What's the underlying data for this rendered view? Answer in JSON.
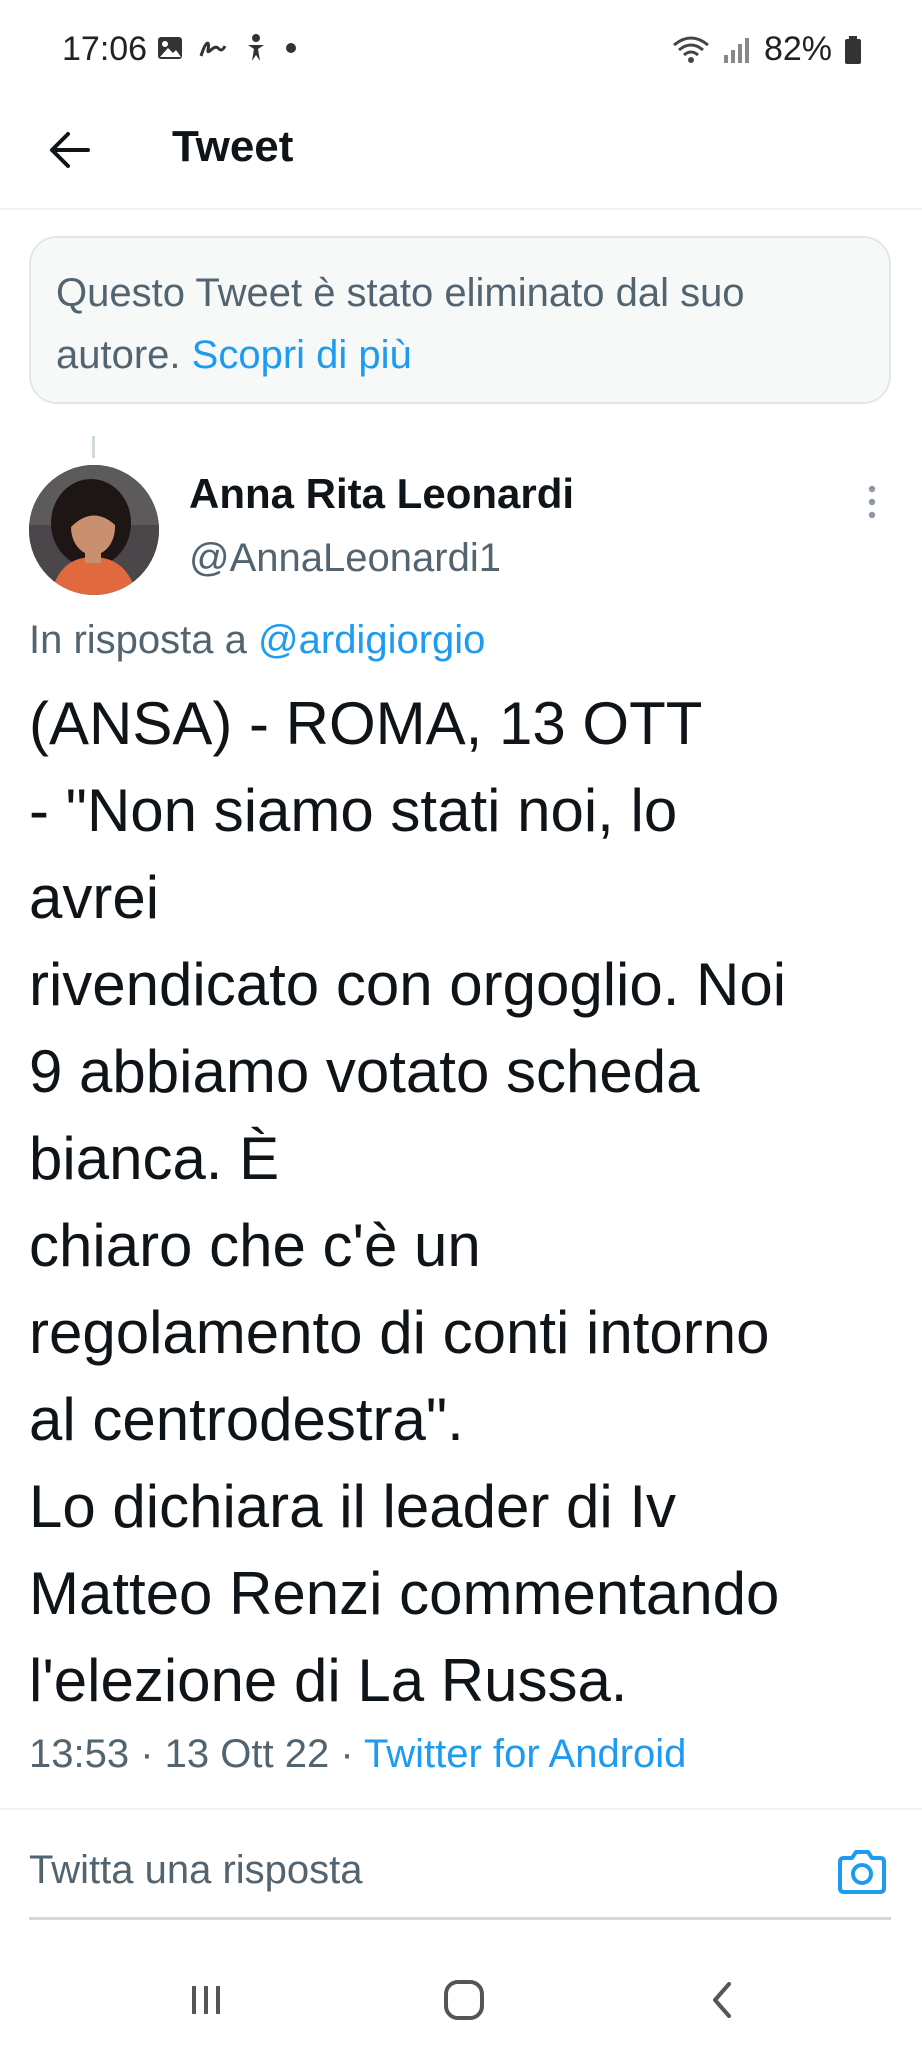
{
  "status_bar": {
    "time": "17:06",
    "battery": "82%"
  },
  "header": {
    "title": "Tweet"
  },
  "deleted_notice": {
    "text": "Questo Tweet è stato eliminato dal suo autore. ",
    "link": "Scopri di più"
  },
  "author": {
    "name": "Anna Rita Leonardi",
    "handle": "@AnnaLeonardi1"
  },
  "reply_to": {
    "prefix": "In risposta a ",
    "handle": "@ardigiorgio"
  },
  "tweet": {
    "text": "(ANSA) - ROMA, 13 OTT\n- \"Non siamo stati noi, lo\navrei\nrivendicato con orgoglio. Noi\n9 abbiamo votato scheda\nbianca. È\nchiaro che c'è un\nregolamento di conti intorno\nal centrodestra\".\nLo dichiara il leader di Iv\nMatteo Renzi commentando\nl'elezione di La Russa.",
    "time": "13:53",
    "date": "13 Ott 22",
    "source": "Twitter for Android"
  },
  "composer": {
    "placeholder": "Twitta una risposta"
  },
  "colors": {
    "accent": "#1d9bf0",
    "text_primary": "#0f1419",
    "text_secondary": "#536471"
  }
}
